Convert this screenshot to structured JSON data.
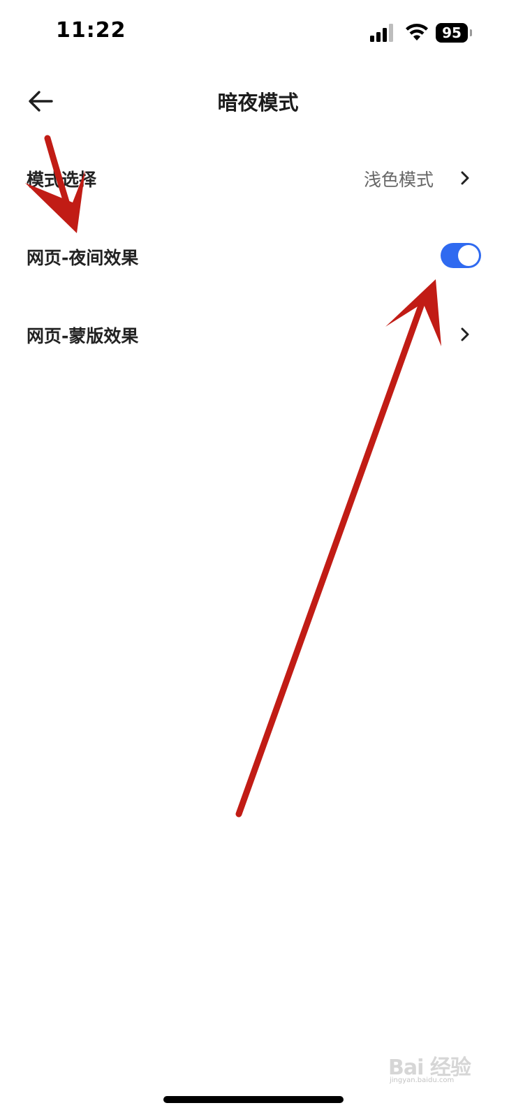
{
  "status_bar": {
    "time": "11:22",
    "battery_level": "95",
    "signal_icon": "cellular-signal-icon",
    "wifi_icon": "wifi-icon"
  },
  "header": {
    "title": "暗夜模式",
    "back_icon": "arrow-left-icon"
  },
  "settings": [
    {
      "label": "模式选择",
      "value": "浅色模式",
      "control": "chevron"
    },
    {
      "label": "网页-夜间效果",
      "control": "toggle",
      "toggle_on": true
    },
    {
      "label": "网页-蒙版效果",
      "control": "chevron"
    }
  ],
  "colors": {
    "toggle_on": "#2f6af0",
    "annotation_arrow": "#c11c15",
    "background": "#ffffff"
  },
  "watermark": {
    "brand": "Bai 经验",
    "url": "jingyan.baidu.com"
  }
}
